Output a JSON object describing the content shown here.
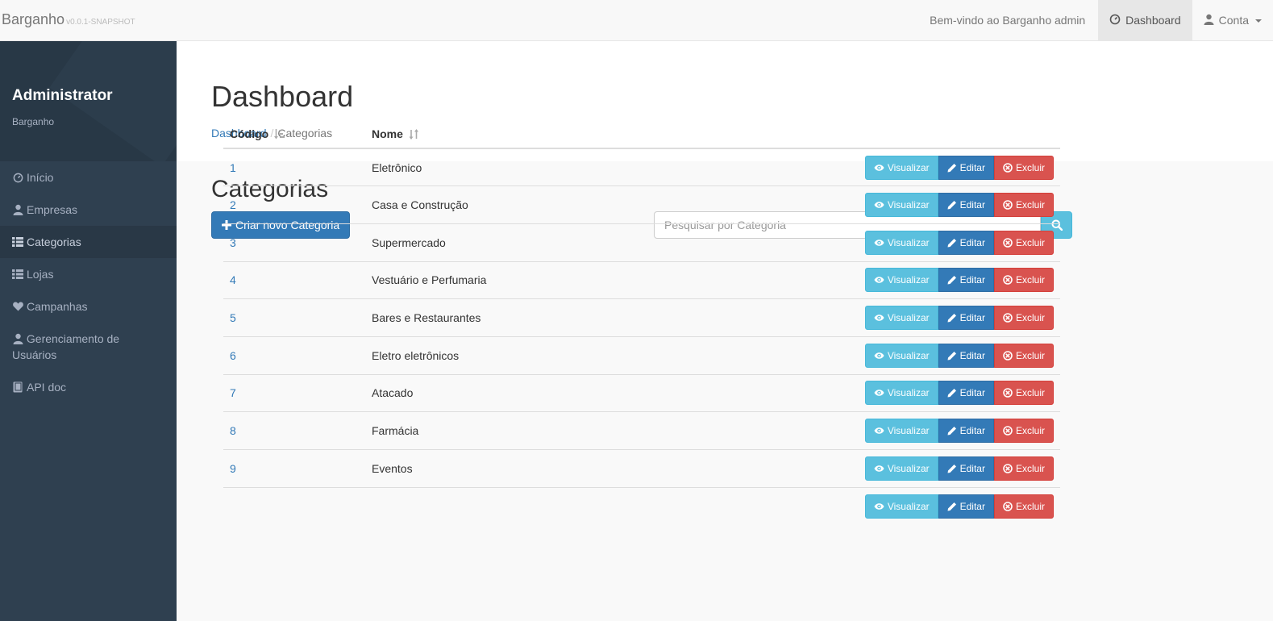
{
  "navbar": {
    "brand": "Barganho",
    "version": "v0.0.1-SNAPSHOT",
    "welcome": "Bem-vindo ao Barganho admin",
    "dashboard": "Dashboard",
    "account": "Conta"
  },
  "sidebar": {
    "user_name": "Administrator",
    "user_sub": "Barganho",
    "items": [
      {
        "label": "Início",
        "icon": "dashboard-icon"
      },
      {
        "label": "Empresas",
        "icon": "user-icon"
      },
      {
        "label": "Categorias",
        "icon": "list-icon"
      },
      {
        "label": "Lojas",
        "icon": "list-icon"
      },
      {
        "label": "Campanhas",
        "icon": "heart-icon"
      },
      {
        "label": "Gerenciamento de Usuários",
        "icon": "user-icon"
      },
      {
        "label": "API doc",
        "icon": "book-icon"
      }
    ],
    "active_index": 2
  },
  "header": {
    "title": "Dashboard",
    "breadcrumb": {
      "home": "Dashboard",
      "current": "Categorias"
    }
  },
  "content": {
    "title": "Categorias",
    "create_button": "Criar novo Categoria",
    "search_placeholder": "Pesquisar por Categoria"
  },
  "table": {
    "columns": [
      "Código",
      "Nome"
    ],
    "actions": {
      "view": "Visualizar",
      "edit": "Editar",
      "delete": "Excluir"
    },
    "rows": [
      {
        "code": "1",
        "name": "Eletrônico"
      },
      {
        "code": "2",
        "name": "Casa e Construção"
      },
      {
        "code": "3",
        "name": "Supermercado"
      },
      {
        "code": "4",
        "name": "Vestuário e Perfumaria"
      },
      {
        "code": "5",
        "name": "Bares e Restaurantes"
      },
      {
        "code": "6",
        "name": "Eletro eletrônicos"
      },
      {
        "code": "7",
        "name": "Atacado"
      },
      {
        "code": "8",
        "name": "Farmácia"
      },
      {
        "code": "9",
        "name": "Eventos"
      },
      {
        "code": "",
        "name": ""
      }
    ]
  },
  "colors": {
    "sidebar_bg": "#2f4050",
    "primary": "#337ab7",
    "info": "#5bc0de",
    "danger": "#d9534f"
  }
}
